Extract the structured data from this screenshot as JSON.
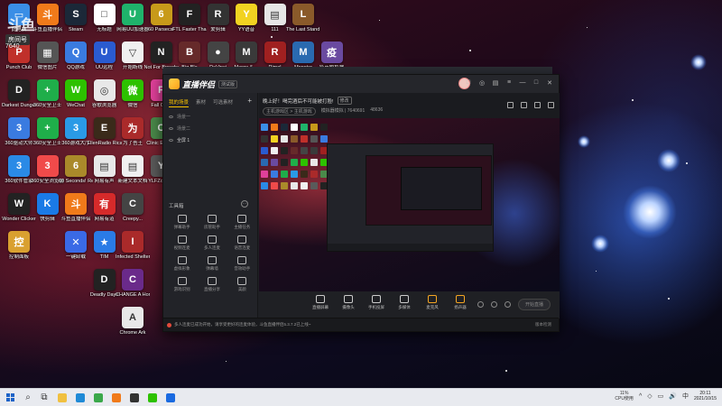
{
  "overlay": {
    "logo": "斗鱼",
    "subtitle": "房间号",
    "room_number": "7640"
  },
  "desktop_icons": [
    {
      "label": "此电脑",
      "color": "#3a8ee6",
      "glyph": "▭"
    },
    {
      "label": "斗鱼直播伴侣",
      "color": "#f07a1a",
      "glyph": "斗"
    },
    {
      "label": "Steam",
      "color": "#1b2838",
      "glyph": "S"
    },
    {
      "label": "无标题",
      "color": "#ffffff",
      "glyph": "□"
    },
    {
      "label": "网易UU加速器",
      "color": "#1fb36b",
      "glyph": "U"
    },
    {
      "label": "60 Parsecs!",
      "color": "#c89a1a",
      "glyph": "6"
    },
    {
      "label": "FTL Faster Than Light",
      "color": "#222222",
      "glyph": "F"
    },
    {
      "label": "爱剪辑",
      "color": "#333333",
      "glyph": "R"
    },
    {
      "label": "YY语音",
      "color": "#f2d221",
      "glyph": "Y"
    },
    {
      "label": "111",
      "color": "#e6e6e6",
      "glyph": "▤"
    },
    {
      "label": "The Last Stand A...",
      "color": "#8a5a2a",
      "glyph": "L"
    },
    {
      "label": "Punch Club",
      "color": "#c0302a",
      "glyph": "P"
    },
    {
      "label": "微信图片",
      "color": "#555555",
      "glyph": "▦"
    },
    {
      "label": "QQ游戏",
      "color": "#3a7be0",
      "glyph": "Q"
    },
    {
      "label": "UU远程",
      "color": "#2a5bd0",
      "glyph": "U"
    },
    {
      "label": "开始断线",
      "color": "#f0f0f0",
      "glyph": "▽"
    },
    {
      "label": "Not For Broadcast",
      "color": "#222222",
      "glyph": "N"
    },
    {
      "label": "Big Bla",
      "color": "#662a2a",
      "glyph": "B"
    },
    {
      "label": "DaVinci",
      "color": "#444444",
      "glyph": "●"
    },
    {
      "label": "Merge & ...",
      "color": "#3a3a3a",
      "glyph": "M"
    },
    {
      "label": "Rimol",
      "color": "#a02020",
      "glyph": "R"
    },
    {
      "label": "Monster",
      "color": "#2a6ab0",
      "glyph": "M"
    },
    {
      "label": "疫苗模拟器",
      "color": "#6a4aa0",
      "glyph": "疫"
    },
    {
      "label": "Darkest Dungeon",
      "color": "#222222",
      "glyph": "D"
    },
    {
      "label": "360安全卫士",
      "color": "#1fae4a",
      "glyph": "+"
    },
    {
      "label": "WeChat",
      "color": "#2dc100",
      "glyph": "W"
    },
    {
      "label": "谷歌浏览器",
      "color": "#e8e8e8",
      "glyph": "◎"
    },
    {
      "label": "微信",
      "color": "#2dc100",
      "glyph": "微"
    },
    {
      "label": "Fall Gu...",
      "color": "#e0409a",
      "glyph": "F"
    },
    {
      "label": "360驱动大师",
      "color": "#3a7be0",
      "glyph": "3"
    },
    {
      "label": "360安全卫士",
      "color": "#1fae4a",
      "glyph": "+"
    },
    {
      "label": "360游戏大厅",
      "color": "#2a9ae6",
      "glyph": "3"
    },
    {
      "label": "EllenRadio Ricant2 ...",
      "color": "#3a2a1a",
      "glyph": "E"
    },
    {
      "label": "为了吾王",
      "color": "#aa2a2a",
      "glyph": "为"
    },
    {
      "label": "Clinic Empire",
      "color": "#4a8a4a",
      "glyph": "C"
    },
    {
      "label": "360软件管家",
      "color": "#2a8ae6",
      "glyph": "3"
    },
    {
      "label": "360安全浏览器",
      "color": "#f04a4a",
      "glyph": "3"
    },
    {
      "label": "60 Seconds! Reatomized",
      "color": "#aa8a2a",
      "glyph": "6"
    },
    {
      "label": "网易有声",
      "color": "#e8e8e8",
      "glyph": "▤"
    },
    {
      "label": "新建文本文档",
      "color": "#f0f0f0",
      "glyph": "▤"
    },
    {
      "label": "YLFZombie",
      "color": "#5a5a5a",
      "glyph": "Y"
    },
    {
      "label": "Wonder Clicker",
      "color": "#222222",
      "glyph": "W"
    },
    {
      "label": "快剪辑",
      "color": "#1a7ae6",
      "glyph": "K"
    },
    {
      "label": "斗鱼直播伴侣",
      "color": "#f07a1a",
      "glyph": "斗"
    },
    {
      "label": "网易有道",
      "color": "#d62a2a",
      "glyph": "有"
    },
    {
      "label": "Creepy...",
      "color": "#444444",
      "glyph": "C"
    },
    {
      "label": "控制面板",
      "color": "#d9a030",
      "glyph": "控"
    },
    {
      "label": "一键卸载",
      "color": "#3a6ae6",
      "glyph": "✕"
    },
    {
      "label": "TIM",
      "color": "#2a7be6",
      "glyph": "★"
    },
    {
      "label": "Infected Shelter",
      "color": "#aa2a2a",
      "glyph": "I"
    },
    {
      "label": "Deadly Days",
      "color": "#222222",
      "glyph": "D"
    },
    {
      "label": "CHANGE A Homeless...",
      "color": "#6a2a8a",
      "glyph": "C"
    },
    {
      "label": "Chrome Ark",
      "color": "#e8e8e8",
      "glyph": "A"
    }
  ],
  "window": {
    "app_name": "直播伴侣",
    "version_tag": "测试版",
    "title_controls": [
      "□",
      "◎",
      "▤",
      "≡",
      "—",
      "□",
      "✕"
    ],
    "tabs": [
      "我的场景",
      "素材",
      "可选素材"
    ],
    "add_label": "+",
    "scenes": [
      "场景一",
      "场景二",
      "全屏 1"
    ],
    "tools_header": "工具箱",
    "tools_more": "···",
    "tools": [
      "弹幕助手",
      "房管助手",
      "主播任务",
      "视频连麦",
      "多人连麦",
      "语音连麦",
      "虚拟形象",
      "弹幕墙",
      "音效助手",
      "游戏识别",
      "直播分享",
      "美颜"
    ],
    "stage_title": "晚上好！喝完酒后不可能被打脸!",
    "stage_tag": "修改",
    "stage_category": "主机游戏区 > 主机游戏",
    "stage_room": "模拟器模拟 | 7640691",
    "stage_hot": "48636",
    "bottom_controls": [
      "直播屏幕",
      "摄像头",
      "手机投屏",
      "多媒体",
      "麦克风",
      "扬声器"
    ],
    "start_button": "开始直播",
    "status_message": "多人连麦已成功开始，请享受更好的连麦体验，斗鱼直播伴侣5.3.7.2已上线~",
    "status_right": "版本检测"
  },
  "taskbar": {
    "search_symbol": "⌕",
    "taskview_symbol": "⧉",
    "apps": [
      {
        "name": "file-explorer",
        "color": "#f0c040"
      },
      {
        "name": "edge",
        "color": "#1f8ad6"
      },
      {
        "name": "chrome",
        "color": "#3aa84a"
      },
      {
        "name": "douyu",
        "color": "#f07a1a"
      },
      {
        "name": "obs",
        "color": "#333333"
      },
      {
        "name": "wechat",
        "color": "#2dc100"
      },
      {
        "name": "mail",
        "color": "#1a6ae0"
      }
    ],
    "cpu_value": "11%",
    "cpu_label": "CPU使用",
    "tray_symbols": [
      "^",
      "◇",
      "▭",
      "🔊",
      "中"
    ],
    "time": "20:11",
    "date": "2021/10/15"
  }
}
